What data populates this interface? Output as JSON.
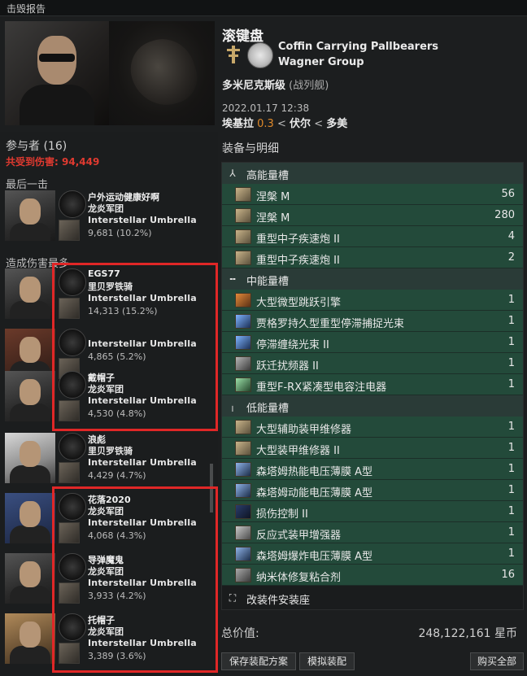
{
  "window": {
    "title": "击毁报告"
  },
  "victim": {
    "name": "滚键盘",
    "corporation": "Coffin Carrying Pallbearers",
    "alliance": "Wagner Group",
    "ship": "多米尼克斯级",
    "ship_class": "(战列舰)",
    "datetime": "2022.01.17 12:38",
    "system": "埃基拉",
    "security": "0.3",
    "constellation": "伏尔",
    "region": "多美",
    "sep": "<"
  },
  "participants": {
    "title": "参与者 (16)",
    "damage_label": "共受到伤害:",
    "damage_value": "94,449",
    "final_blow_title": "最后一击",
    "top_damage_title": "造成伤害最多"
  },
  "attackers": [
    {
      "name": "户外运动健康好啊",
      "corp": "龙炎军团",
      "ship": "Interstellar Umbrella",
      "dmg": "9,681 (10.2%)"
    },
    {
      "name": "EGS77",
      "corp": "里贝罗铁骑",
      "ship": "Interstellar Umbrella",
      "dmg": "14,313 (15.2%)"
    },
    {
      "name": "",
      "corp": "",
      "ship": "Interstellar Umbrella",
      "dmg": "4,865 (5.2%)"
    },
    {
      "name": "戴帽子",
      "corp": "龙炎军团",
      "ship": "Interstellar Umbrella",
      "dmg": "4,530 (4.8%)"
    },
    {
      "name": "浪彪",
      "corp": "里贝罗铁骑",
      "ship": "Interstellar Umbrella",
      "dmg": "4,429 (4.7%)"
    },
    {
      "name": "花落2020",
      "corp": "龙炎军团",
      "ship": "Interstellar Umbrella",
      "dmg": "4,068 (4.3%)"
    },
    {
      "name": "导弹魔鬼",
      "corp": "龙炎军团",
      "ship": "Interstellar Umbrella",
      "dmg": "3,933 (4.2%)"
    },
    {
      "name": "托帽子",
      "corp": "龙炎军团",
      "ship": "Interstellar Umbrella",
      "dmg": "3,389 (3.6%)"
    }
  ],
  "fitting": {
    "title": "装备与明细",
    "high_slots": "高能量槽",
    "mid_slots": "中能量槽",
    "low_slots": "低能量槽",
    "rig_slots": "改装件安装座",
    "high": [
      {
        "name": "涅槃 M",
        "qty": "56"
      },
      {
        "name": "涅槃 M",
        "qty": "280"
      },
      {
        "name": "重型中子疾速炮 II",
        "qty": "4"
      },
      {
        "name": "重型中子疾速炮 II",
        "qty": "2"
      }
    ],
    "mid": [
      {
        "name": "大型微型跳跃引擎",
        "qty": "1"
      },
      {
        "name": "贾格罗持久型重型停滞捕捉光束",
        "qty": "1"
      },
      {
        "name": "停滞缠绕光束 II",
        "qty": "1"
      },
      {
        "name": "跃迁扰频器 II",
        "qty": "1"
      },
      {
        "name": "重型F-RX紧凑型电容注电器",
        "qty": "1"
      }
    ],
    "low": [
      {
        "name": "大型辅助装甲维修器",
        "qty": "1"
      },
      {
        "name": "大型装甲维修器 II",
        "qty": "1"
      },
      {
        "name": "森塔姆热能电压薄膜 A型",
        "qty": "1"
      },
      {
        "name": "森塔姆动能电压薄膜 A型",
        "qty": "1"
      },
      {
        "name": "损伤控制 II",
        "qty": "1"
      },
      {
        "name": "反应式装甲增强器",
        "qty": "1"
      },
      {
        "name": "森塔姆爆炸电压薄膜 A型",
        "qty": "1"
      },
      {
        "name": "纳米体修复粘合剂",
        "qty": "16"
      }
    ]
  },
  "totals": {
    "label": "总价值:",
    "value": "248,122,161 星币"
  },
  "buttons": {
    "save_fit": "保存装配方案",
    "simulate": "模拟装配",
    "buy_all": "购买全部"
  }
}
